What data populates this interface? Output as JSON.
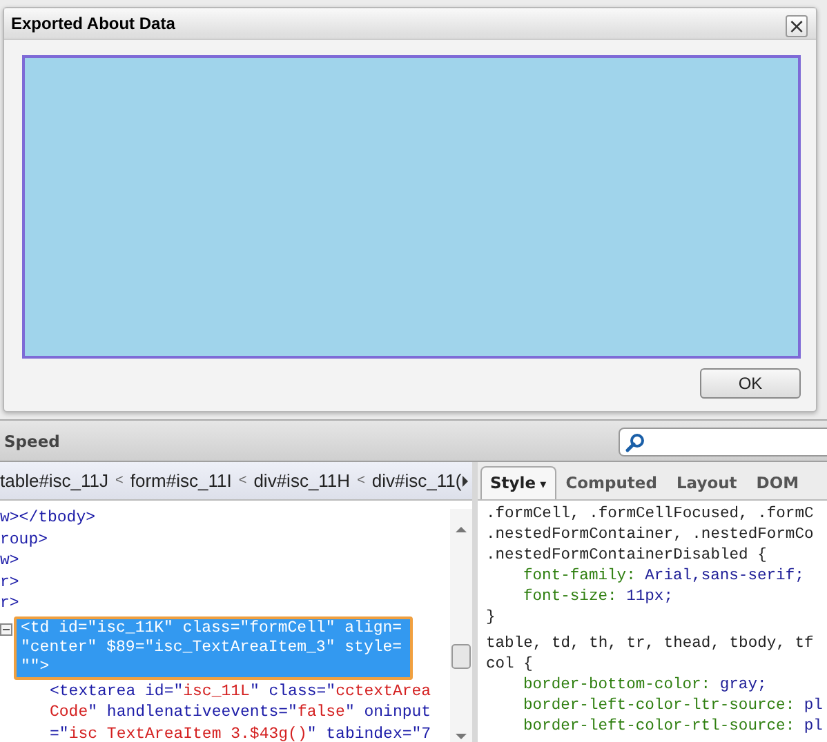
{
  "dialog": {
    "title": "Exported About Data",
    "close": "×",
    "ok_button": "OK"
  },
  "toolbar": {
    "title": "Speed"
  },
  "breadcrumb": [
    {
      "label": "table#isc_11J"
    },
    {
      "label": "form#isc_11I"
    },
    {
      "label": "div#isc_11H"
    },
    {
      "label": "div#isc_11("
    }
  ],
  "breadcrumb_separator": "<",
  "html_lines": [
    {
      "kind": "plain",
      "selected": false,
      "parts": [
        {
          "kind": "tag",
          "text": "w></tbody>"
        }
      ]
    },
    {
      "kind": "plain",
      "selected": false,
      "parts": [
        {
          "kind": "tag",
          "text": "roup>"
        }
      ]
    },
    {
      "kind": "plain",
      "selected": false,
      "parts": [
        {
          "kind": "tag",
          "text": "w>"
        }
      ]
    },
    {
      "kind": "plain",
      "selected": false,
      "parts": [
        {
          "kind": "tag",
          "text": "r>"
        }
      ]
    },
    {
      "kind": "plain",
      "selected": false,
      "parts": [
        {
          "kind": "tag",
          "text": "r>"
        }
      ]
    },
    {
      "kind": "element",
      "selected": true,
      "expanded": true,
      "parts": [
        {
          "kind": "tag",
          "text": "<td id=\"isc_11K\" class=\"formCell\" align=\n\"center\" $89=\"isc_TextAreaItem_3\" style=\n\"\">"
        }
      ]
    },
    {
      "kind": "child",
      "selected": false,
      "parts": [
        {
          "kind": "tag",
          "text": "<textarea id=\""
        },
        {
          "kind": "value",
          "text": "isc_11L"
        },
        {
          "kind": "tag",
          "text": "\" class=\""
        },
        {
          "kind": "value",
          "text": "cctextArea\nCode"
        },
        {
          "kind": "tag",
          "text": "\" handlenativeevents=\""
        },
        {
          "kind": "value",
          "text": "false"
        },
        {
          "kind": "tag",
          "text": "\" oninput\n=\""
        },
        {
          "kind": "value",
          "text": "isc TextAreaItem 3.$43g()"
        },
        {
          "kind": "tag",
          "text": "\" tabindex=\"7"
        }
      ]
    }
  ],
  "style_tabs": [
    {
      "label": "Style",
      "selected": true,
      "menu": "▾"
    },
    {
      "label": "Computed",
      "selected": false
    },
    {
      "label": "Layout",
      "selected": false
    },
    {
      "label": "DOM",
      "selected": false
    }
  ],
  "css_lines": [
    {
      "kind": "selector",
      "text": ".formCell, .formCellFocused, .formC"
    },
    {
      "kind": "selector",
      "text": ".nestedFormContainer, .nestedFormCo"
    },
    {
      "kind": "selector",
      "text": ".nestedFormContainerDisabled {"
    },
    {
      "kind": "property",
      "name": "font-family:",
      "value": "Arial,sans-serif;"
    },
    {
      "kind": "property",
      "name": "font-size:",
      "value": "11px;"
    },
    {
      "kind": "close",
      "text": "}"
    },
    {
      "kind": "selector",
      "text": "table, td, th, tr, thead, tbody, tf"
    },
    {
      "kind": "selector",
      "text": "col {"
    },
    {
      "kind": "property",
      "name": "border-bottom-color:",
      "value": "gray;"
    },
    {
      "kind": "property",
      "name": "border-left-color-ltr-source:",
      "value": "pl"
    },
    {
      "kind": "property",
      "name": "border-left-color-rtl-source:",
      "value": "pl"
    }
  ]
}
